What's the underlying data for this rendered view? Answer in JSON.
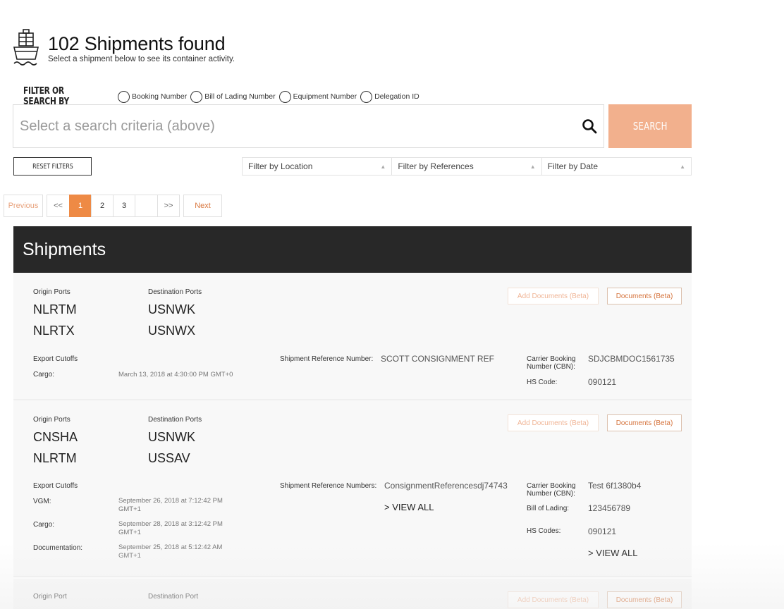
{
  "header": {
    "title": "102 Shipments found",
    "subtitle": "Select a shipment below to see its container activity.",
    "icon": "cargo-ship-icon"
  },
  "filter": {
    "label": "FILTER OR SEARCH BY",
    "options": [
      "Booking Number",
      "Bill of Lading Number",
      "Equipment Number",
      "Delegation ID"
    ]
  },
  "search": {
    "placeholder": "Select a search criteria (above)",
    "button_label": "SEARCH",
    "button_color": "#f2b08d"
  },
  "reset_label": "RESET FILTERS",
  "dropdowns": {
    "location": "Filter by Location",
    "references": "Filter by References",
    "date": "Filter by Date"
  },
  "pagination": {
    "previous": "Previous",
    "first": "<<",
    "pages": [
      "1",
      "2",
      "3"
    ],
    "active_page": "1",
    "last": ">>",
    "next": "Next",
    "accent": "#ee8a45"
  },
  "section_title": "Shipments",
  "cards": [
    {
      "origin_label": "Origin Ports",
      "destination_label": "Destination Ports",
      "origins": [
        "NLRTM",
        "NLRTX"
      ],
      "destinations": [
        "USNWK",
        "USNWX"
      ],
      "add_docs": "Add Documents (Beta)",
      "docs": "Documents (Beta)",
      "cutoffs_label": "Export Cutoffs",
      "cutoffs": [
        {
          "label": "Cargo:",
          "value": "March 13, 2018 at 4:30:00 PM GMT+0"
        }
      ],
      "ref_label": "Shipment Reference Number:",
      "ref_value": "SCOTT CONSIGNMENT REF",
      "cbn_label": "Carrier Booking Number (CBN):",
      "cbn_value": "SDJCBMDOC1561735",
      "hs_label": "HS Code:",
      "hs_value": "090121"
    },
    {
      "origin_label": "Origin Ports",
      "destination_label": "Destination Ports",
      "origins": [
        "CNSHA",
        "NLRTM"
      ],
      "destinations": [
        "USNWK",
        "USSAV"
      ],
      "add_docs": "Add Documents (Beta)",
      "docs": "Documents (Beta)",
      "cutoffs_label": "Export Cutoffs",
      "cutoffs": [
        {
          "label": "VGM:",
          "value": "September 26, 2018 at 7:12:42 PM GMT+1"
        },
        {
          "label": "Cargo:",
          "value": "September 28, 2018 at 3:12:42 PM GMT+1"
        },
        {
          "label": "Documentation:",
          "value": "September 25, 2018 at 5:12:42 AM GMT+1"
        }
      ],
      "ref_label": "Shipment Reference Numbers:",
      "ref_value": "ConsignmentReferencesdj74743",
      "ref_view_all": "> VIEW ALL",
      "cbn_label": "Carrier Booking Number (CBN):",
      "cbn_value": "Test 6f1380b4",
      "bol_label": "Bill of Lading:",
      "bol_value": "123456789",
      "hs_label": "HS Codes:",
      "hs_value": "090121",
      "hs_view_all": "> VIEW ALL"
    },
    {
      "origin_label": "Origin Port",
      "destination_label": "Destination Port",
      "add_docs": "Add Documents (Beta)",
      "docs": "Documents (Beta)"
    }
  ]
}
